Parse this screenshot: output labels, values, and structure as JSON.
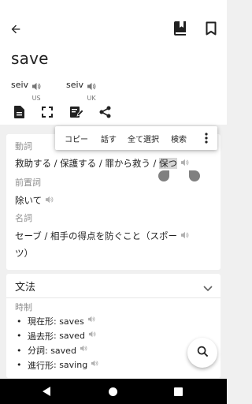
{
  "entry": {
    "word": "save",
    "pronunciations": [
      {
        "ipa": "seiv",
        "region": "US"
      },
      {
        "ipa": "seiv",
        "region": "UK"
      }
    ]
  },
  "icons": {
    "back": "arrow-back-icon",
    "book": "book-icon",
    "bookmark": "bookmark-icon",
    "document": "document-icon",
    "fullscreen": "fullscreen-icon",
    "note": "edit-note-icon",
    "share": "share-icon",
    "speaker": "speaker-icon",
    "search": "search-icon"
  },
  "definitions": {
    "verb": {
      "pos": "動詞",
      "text_before": "救助する / 保護する / 罪から救う / ",
      "text_selected": "保つ"
    },
    "preposition": {
      "pos": "前置詞",
      "text": "除いて"
    },
    "noun": {
      "pos": "名詞",
      "line1": "セーブ / 相手の得点を防ぐこと（スポー",
      "line2": "ツ）"
    }
  },
  "selection_menu": [
    "コピー",
    "話す",
    "全て選択",
    "検索"
  ],
  "grammar": {
    "title": "文法",
    "tense_heading": "時制",
    "forms": [
      {
        "label": "現在形",
        "value": "saves"
      },
      {
        "label": "過去形",
        "value": "saved"
      },
      {
        "label": "分詞",
        "value": "saved"
      },
      {
        "label": "進行形",
        "value": "saving"
      }
    ]
  },
  "colors": {
    "accent_gray": "#757575",
    "selection": "#d6d6d6",
    "handle": "#808080"
  }
}
